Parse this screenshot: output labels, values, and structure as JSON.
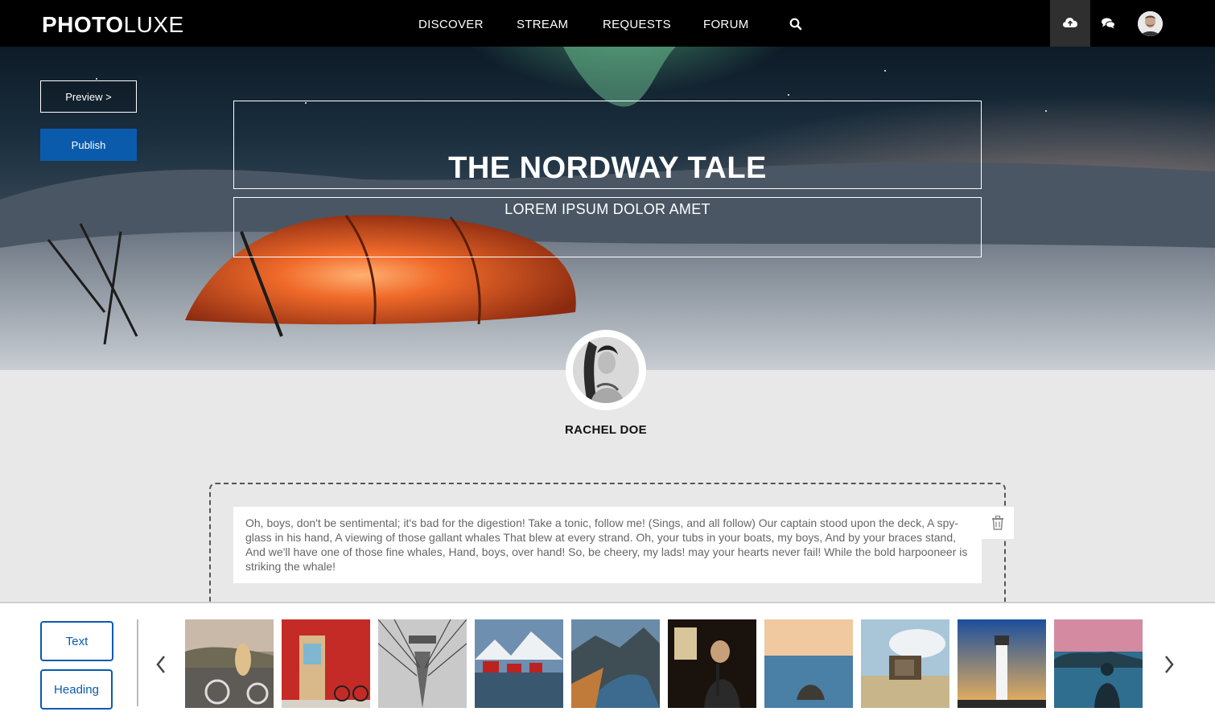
{
  "brand": {
    "part1": "PHOTO",
    "part2": "LUXE"
  },
  "nav": {
    "items": [
      "DISCOVER",
      "STREAM",
      "REQUESTS",
      "FORUM"
    ]
  },
  "hero": {
    "preview_label": "Preview >",
    "publish_label": "Publish",
    "title": "THE NORDWAY TALE",
    "subtitle": "LOREM IPSUM DOLOR AMET"
  },
  "author": {
    "name": "RACHEL DOE"
  },
  "editor": {
    "text": "Oh, boys, don't be sentimental; it's bad for the digestion! Take a tonic, follow me! (Sings, and all follow) Our captain stood upon the deck, A spy-glass in his hand, A viewing of those gallant whales That blew at every strand. Oh, your tubs in your boats, my boys, And by your braces stand, And we'll have one of those fine whales, Hand, boys, over hand! So, be cheery, my lads! may your hearts never fail! While the bold harpooneer is striking the whale!"
  },
  "toolbar": {
    "text_label": "Text",
    "heading_label": "Heading"
  },
  "colors": {
    "accent": "#0b5bad",
    "tent": "#e0501e"
  }
}
